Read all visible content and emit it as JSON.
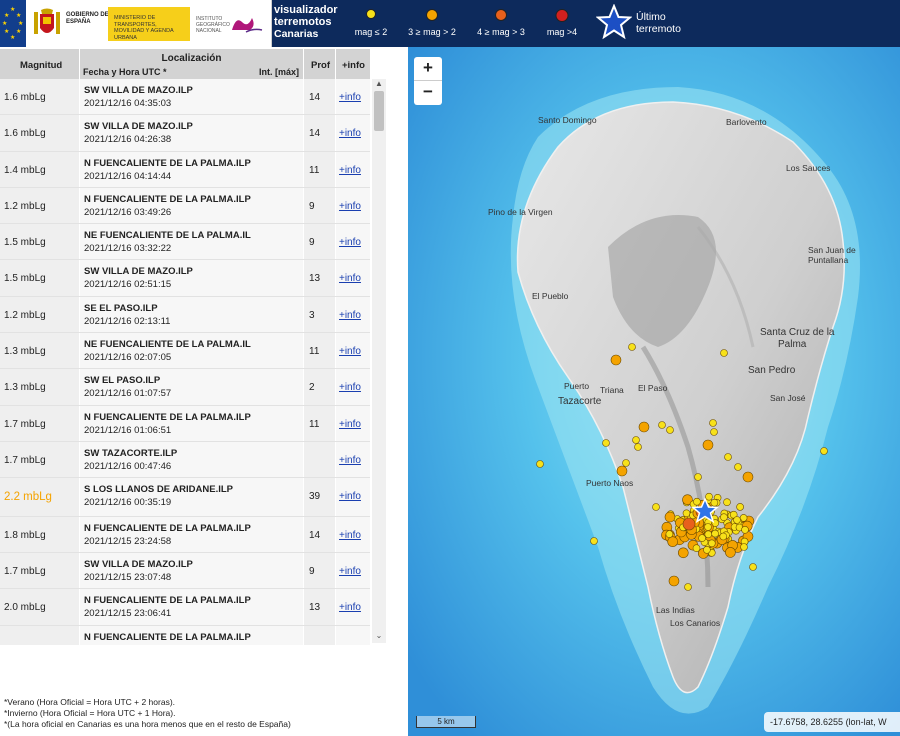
{
  "header": {
    "gov_logo_text": "GOBIERNO DE ESPAÑA",
    "ministry_text": "MINISTERIO DE TRANSPORTES, MOVILIDAD Y AGENDA URBANA",
    "institute_text": "INSTITUTO GEOGRÁFICO NACIONAL",
    "app_title_line1": "visualizador",
    "app_title_line2": "terremotos",
    "app_title_line3": "Canarias",
    "legend": [
      {
        "label": "mag ≤ 2",
        "color": "#f7e11a",
        "size": 10
      },
      {
        "label": "3 ≥ mag > 2",
        "color": "#f4a300",
        "size": 12
      },
      {
        "label": "4 ≥ mag > 3",
        "color": "#e8601c",
        "size": 13
      },
      {
        "label": "mag >4",
        "color": "#d2201f",
        "size": 14
      }
    ],
    "ultimo_line1": "Último",
    "ultimo_line2": "terremoto"
  },
  "table": {
    "headers": {
      "magnitud": "Magnitud",
      "localizacion": "Localización",
      "fecha": "Fecha y Hora UTC *",
      "intensidad": "Int. [máx]",
      "prof": "Prof",
      "info": "+info"
    },
    "rows": [
      {
        "mag": "1.6 mbLg",
        "place": "SW VILLA DE MAZO.ILP",
        "date": "2021/12/16 04:35:03",
        "prof": "14",
        "info": "+info"
      },
      {
        "mag": "1.6 mbLg",
        "place": "SW VILLA DE MAZO.ILP",
        "date": "2021/12/16 04:26:38",
        "prof": "14",
        "info": "+info"
      },
      {
        "mag": "1.4 mbLg",
        "place": "N FUENCALIENTE DE LA PALMA.ILP",
        "date": "2021/12/16 04:14:44",
        "prof": "11",
        "info": "+info"
      },
      {
        "mag": "1.2 mbLg",
        "place": "N FUENCALIENTE DE LA PALMA.ILP",
        "date": "2021/12/16 03:49:26",
        "prof": "9",
        "info": "+info"
      },
      {
        "mag": "1.5 mbLg",
        "place": "NE FUENCALIENTE DE LA PALMA.IL",
        "date": "2021/12/16 03:32:22",
        "prof": "9",
        "info": "+info"
      },
      {
        "mag": "1.5 mbLg",
        "place": "SW VILLA DE MAZO.ILP",
        "date": "2021/12/16 02:51:15",
        "prof": "13",
        "info": "+info"
      },
      {
        "mag": "1.2 mbLg",
        "place": "SE EL PASO.ILP",
        "date": "2021/12/16 02:13:11",
        "prof": "3",
        "info": "+info"
      },
      {
        "mag": "1.3 mbLg",
        "place": "NE FUENCALIENTE DE LA PALMA.IL",
        "date": "2021/12/16 02:07:05",
        "prof": "11",
        "info": "+info"
      },
      {
        "mag": "1.3 mbLg",
        "place": "SW EL PASO.ILP",
        "date": "2021/12/16 01:07:57",
        "prof": "2",
        "info": "+info"
      },
      {
        "mag": "1.7 mbLg",
        "place": "N FUENCALIENTE DE LA PALMA.ILP",
        "date": "2021/12/16 01:06:51",
        "prof": "11",
        "info": "+info"
      },
      {
        "mag": "1.7 mbLg",
        "place": "SW TAZACORTE.ILP",
        "date": "2021/12/16 00:47:46",
        "prof": "",
        "info": "+info"
      },
      {
        "mag": "2.2 mbLg",
        "place": "S LOS LLANOS DE ARIDANE.ILP",
        "date": "2021/12/16 00:35:19",
        "prof": "39",
        "info": "+info",
        "highlight": true
      },
      {
        "mag": "1.8 mbLg",
        "place": "N FUENCALIENTE DE LA PALMA.ILP",
        "date": "2021/12/15 23:24:58",
        "prof": "14",
        "info": "+info"
      },
      {
        "mag": "1.7 mbLg",
        "place": "SW VILLA DE MAZO.ILP",
        "date": "2021/12/15 23:07:48",
        "prof": "9",
        "info": "+info"
      },
      {
        "mag": "2.0 mbLg",
        "place": "N FUENCALIENTE DE LA PALMA.ILP",
        "date": "2021/12/15 23:06:41",
        "prof": "13",
        "info": "+info"
      },
      {
        "mag": "",
        "place": "N FUENCALIENTE DE LA PALMA.ILP",
        "date": "",
        "prof": "",
        "info": ""
      }
    ]
  },
  "footnotes": {
    "line1": "*Verano (Hora Oficial = Hora UTC + 2 horas).",
    "line2": "*Invierno (Hora Oficial = Hora UTC + 1 Hora).",
    "line3": "*(La hora oficial en Canarias es una hora menos que en el resto de España)"
  },
  "map": {
    "zoom_in": "+",
    "zoom_out": "−",
    "scale": "5 km",
    "coords": "-17.6758, 28.6255 (lon-lat, W",
    "places": {
      "santo_domingo": "Santo Domingo",
      "barlovento": "Barlovento",
      "los_sauces": "Los Sauces",
      "pino": "Pino de la Virgen",
      "san_juan_1": "San Juan de",
      "san_juan_2": "Puntallana",
      "el_pueblo": "El Pueblo",
      "santa_cruz_1": "Santa Cruz de la",
      "santa_cruz_2": "Palma",
      "san_pedro": "San Pedro",
      "puerto": "Puerto",
      "triana": "Triana",
      "el_paso": "El Paso",
      "tazacorte": "Tazacorte",
      "san_jose": "San José",
      "puerto_naos": "Puerto Naos",
      "las_indias": "Las Indias",
      "los_canarios": "Los Canarios"
    }
  }
}
